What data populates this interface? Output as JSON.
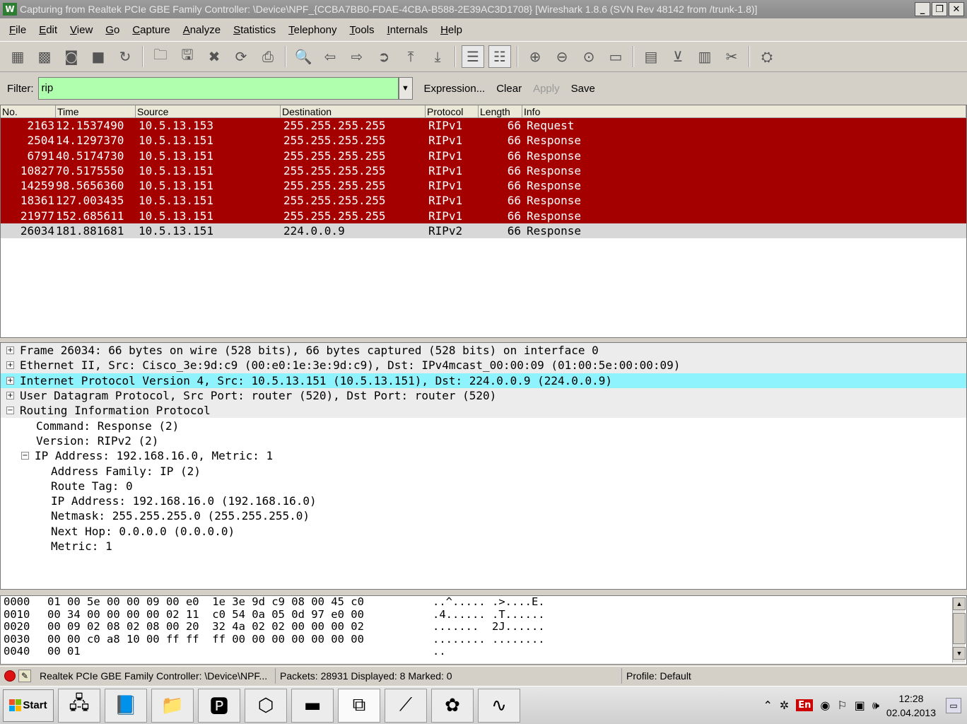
{
  "window": {
    "title": "Capturing from Realtek PCIe GBE Family Controller: \\Device\\NPF_{CCBA7BB0-FDAE-4CBA-B588-2E39AC3D1708}   [Wireshark 1.8.6  (SVN Rev 48142 from /trunk-1.8)]",
    "logo_text": "W",
    "controls": {
      "minimize": "_",
      "restore": "❐",
      "close": "✕"
    }
  },
  "menu": [
    "File",
    "Edit",
    "View",
    "Go",
    "Capture",
    "Analyze",
    "Statistics",
    "Telephony",
    "Tools",
    "Internals",
    "Help"
  ],
  "toolbar": {
    "icons": [
      "interface-list-icon",
      "capture-options-icon",
      "start-capture-icon",
      "stop-capture-icon",
      "restart-capture-icon",
      "|",
      "open-file-icon",
      "save-file-icon",
      "close-file-icon",
      "reload-icon",
      "print-icon",
      "|",
      "find-packet-icon",
      "go-back-icon",
      "go-forward-icon",
      "go-to-packet-icon",
      "go-first-icon",
      "go-last-icon",
      "|",
      "colorize-icon",
      "auto-scroll-icon",
      "|",
      "zoom-in-icon",
      "zoom-out-icon",
      "zoom-normal-icon",
      "resize-columns-icon",
      "|",
      "capture-filters-icon",
      "display-filters-icon",
      "coloring-rules-icon",
      "preferences-icon",
      "|",
      "help-icon"
    ],
    "glyphs": {
      "interface-list-icon": "▦",
      "capture-options-icon": "▩",
      "start-capture-icon": "◙",
      "stop-capture-icon": "■",
      "restart-capture-icon": "↻",
      "open-file-icon": "🗀",
      "save-file-icon": "🖫",
      "close-file-icon": "✖",
      "reload-icon": "⟳",
      "print-icon": "⎙",
      "find-packet-icon": "🔍",
      "go-back-icon": "⇦",
      "go-forward-icon": "⇨",
      "go-to-packet-icon": "➲",
      "go-first-icon": "⤒",
      "go-last-icon": "⤓",
      "colorize-icon": "☰",
      "auto-scroll-icon": "☷",
      "zoom-in-icon": "⊕",
      "zoom-out-icon": "⊖",
      "zoom-normal-icon": "⊙",
      "resize-columns-icon": "▭",
      "capture-filters-icon": "▤",
      "display-filters-icon": "⊻",
      "coloring-rules-icon": "▥",
      "preferences-icon": "✂",
      "help-icon": "⛭"
    },
    "pressed": [
      "colorize-icon",
      "auto-scroll-icon"
    ]
  },
  "filter": {
    "label": "Filter:",
    "value": "rip",
    "bg_color": "#afffaf",
    "expression": "Expression...",
    "clear": "Clear",
    "apply": "Apply",
    "save": "Save"
  },
  "packet_list": {
    "columns": [
      "No.",
      "Time",
      "Source",
      "Destination",
      "Protocol",
      "Length",
      "Info"
    ],
    "row_colors": {
      "red": "#a40000",
      "selected": "#d8d8d8"
    },
    "rows": [
      {
        "no": "2163",
        "time": "12.1537490",
        "src": "10.5.13.153",
        "dst": "255.255.255.255",
        "proto": "RIPv1",
        "len": "66",
        "info": "Request",
        "style": "red"
      },
      {
        "no": "2504",
        "time": "14.1297370",
        "src": "10.5.13.151",
        "dst": "255.255.255.255",
        "proto": "RIPv1",
        "len": "66",
        "info": "Response",
        "style": "red"
      },
      {
        "no": "6791",
        "time": "40.5174730",
        "src": "10.5.13.151",
        "dst": "255.255.255.255",
        "proto": "RIPv1",
        "len": "66",
        "info": "Response",
        "style": "red"
      },
      {
        "no": "10827",
        "time": "70.5175550",
        "src": "10.5.13.151",
        "dst": "255.255.255.255",
        "proto": "RIPv1",
        "len": "66",
        "info": "Response",
        "style": "red"
      },
      {
        "no": "14259",
        "time": "98.5656360",
        "src": "10.5.13.151",
        "dst": "255.255.255.255",
        "proto": "RIPv1",
        "len": "66",
        "info": "Response",
        "style": "red"
      },
      {
        "no": "18361",
        "time": "127.003435",
        "src": "10.5.13.151",
        "dst": "255.255.255.255",
        "proto": "RIPv1",
        "len": "66",
        "info": "Response",
        "style": "red"
      },
      {
        "no": "21977",
        "time": "152.685611",
        "src": "10.5.13.151",
        "dst": "255.255.255.255",
        "proto": "RIPv1",
        "len": "66",
        "info": "Response",
        "style": "red"
      },
      {
        "no": "26034",
        "time": "181.881681",
        "src": "10.5.13.151",
        "dst": "224.0.0.9",
        "proto": "RIPv2",
        "len": "66",
        "info": "Response",
        "style": "sel"
      }
    ]
  },
  "details": {
    "highlight_color": "#8ef3fc",
    "rows": [
      {
        "level": 0,
        "exp": "+",
        "text": "Frame 26034: 66 bytes on wire (528 bits), 66 bytes captured (528 bits) on interface 0",
        "style": "hdr"
      },
      {
        "level": 0,
        "exp": "+",
        "text": "Ethernet II, Src: Cisco_3e:9d:c9 (00:e0:1e:3e:9d:c9), Dst: IPv4mcast_00:00:09 (01:00:5e:00:00:09)",
        "style": "hdr"
      },
      {
        "level": 0,
        "exp": "+",
        "text": "Internet Protocol Version 4, Src: 10.5.13.151 (10.5.13.151), Dst: 224.0.0.9 (224.0.0.9)",
        "style": "hl"
      },
      {
        "level": 0,
        "exp": "+",
        "text": "User Datagram Protocol, Src Port: router (520), Dst Port: router (520)",
        "style": "hdr"
      },
      {
        "level": 0,
        "exp": "−",
        "text": "Routing Information Protocol",
        "style": "hdr"
      },
      {
        "level": 1,
        "exp": "",
        "text": "Command: Response (2)",
        "style": ""
      },
      {
        "level": 1,
        "exp": "",
        "text": "Version: RIPv2 (2)",
        "style": ""
      },
      {
        "level": 1,
        "exp": "−",
        "text": "IP Address: 192.168.16.0, Metric: 1",
        "style": ""
      },
      {
        "level": 2,
        "exp": "",
        "text": "Address Family: IP (2)",
        "style": ""
      },
      {
        "level": 2,
        "exp": "",
        "text": "Route Tag: 0",
        "style": ""
      },
      {
        "level": 2,
        "exp": "",
        "text": "IP Address: 192.168.16.0 (192.168.16.0)",
        "style": ""
      },
      {
        "level": 2,
        "exp": "",
        "text": "Netmask: 255.255.255.0 (255.255.255.0)",
        "style": ""
      },
      {
        "level": 2,
        "exp": "",
        "text": "Next Hop: 0.0.0.0 (0.0.0.0)",
        "style": ""
      },
      {
        "level": 2,
        "exp": "",
        "text": "Metric: 1",
        "style": ""
      }
    ]
  },
  "hex": {
    "rows": [
      {
        "off": "0000",
        "bytes": "01 00 5e 00 00 09 00 e0  1e 3e 9d c9 08 00 45 c0",
        "ascii": "..^..... .>....E."
      },
      {
        "off": "0010",
        "bytes": "00 34 00 00 00 00 02 11  c0 54 0a 05 0d 97 e0 00",
        "ascii": ".4...... .T......"
      },
      {
        "off": "0020",
        "bytes": "00 09 02 08 02 08 00 20  32 4a 02 02 00 00 00 02",
        "ascii": ".......  2J......"
      },
      {
        "off": "0030",
        "bytes": "00 00 c0 a8 10 00 ff ff  ff 00 00 00 00 00 00 00",
        "ascii": "........ ........"
      },
      {
        "off": "0040",
        "bytes": "00 01",
        "ascii": ".."
      }
    ],
    "scroll_up": "▲",
    "scroll_down": "▼"
  },
  "status": {
    "interface": "Realtek PCIe GBE Family Controller: \\Device\\NPF...",
    "packets": "Packets: 28931 Displayed: 8 Marked: 0",
    "profile": "Profile: Default"
  },
  "taskbar": {
    "start": "Start",
    "start_colors": [
      "#f25022",
      "#7fba00",
      "#00a4ef",
      "#ffb900"
    ],
    "apps": [
      {
        "name": "network-app-icon",
        "glyph": "🖧",
        "active": false
      },
      {
        "name": "notes-app-icon",
        "glyph": "📘",
        "active": false
      },
      {
        "name": "explorer-app-icon",
        "glyph": "📁",
        "active": false
      },
      {
        "name": "powerpoint-app-icon",
        "glyph": "🅿",
        "active": false
      },
      {
        "name": "virtualbox-app-icon",
        "glyph": "⬡",
        "active": false
      },
      {
        "name": "cmd-app-icon",
        "glyph": "▬",
        "active": false
      },
      {
        "name": "acrobat-app-icon",
        "glyph": "⧉",
        "active": true
      },
      {
        "name": "cable-app-icon",
        "glyph": "⟋",
        "active": false
      },
      {
        "name": "flower-app-icon",
        "glyph": "✿",
        "active": false
      },
      {
        "name": "wireshark-app-icon",
        "glyph": "∿",
        "active": false
      }
    ],
    "tray": {
      "chevron": "⌃",
      "lang": "En",
      "icons": [
        "✲",
        "◉",
        "⚐",
        "▣",
        "🕪"
      ],
      "time": "12:28",
      "date": "02.04.2013",
      "show_desktop": "▭"
    }
  }
}
